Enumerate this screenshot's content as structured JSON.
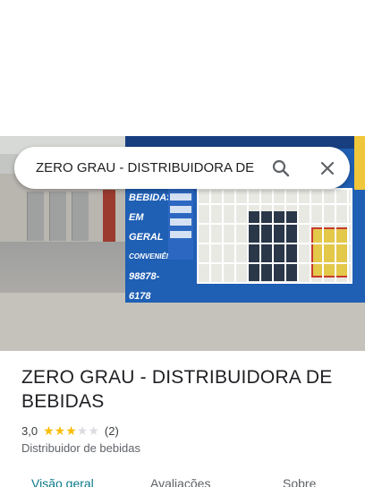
{
  "search": {
    "query": "ZERO GRAU - DISTRIBUIDORA DE BEBIDAS",
    "search_icon": "search-icon",
    "close_icon": "close-icon"
  },
  "photo": {
    "description_icon": "storefront-photo",
    "sign_lines": [
      "BEBIDAS",
      "EM GERAL",
      "CONVENIÊNCIA",
      "98878-6178"
    ]
  },
  "place": {
    "title": "ZERO GRAU - DISTRIBUIDORA DE BEBIDAS",
    "rating": "3,0",
    "stars_filled": 3,
    "stars_total": 5,
    "review_count": "(2)",
    "category": "Distribuidor de bebidas"
  },
  "tabs": [
    {
      "label": "Visão geral",
      "active": true
    },
    {
      "label": "Avaliações",
      "active": false
    },
    {
      "label": "Sobre",
      "active": false
    }
  ],
  "colors": {
    "star_on": "#fbbc04",
    "star_off": "#dadce0",
    "tab_active": "#0b7a8a",
    "kiosk_blue": "#1f5fb4"
  }
}
